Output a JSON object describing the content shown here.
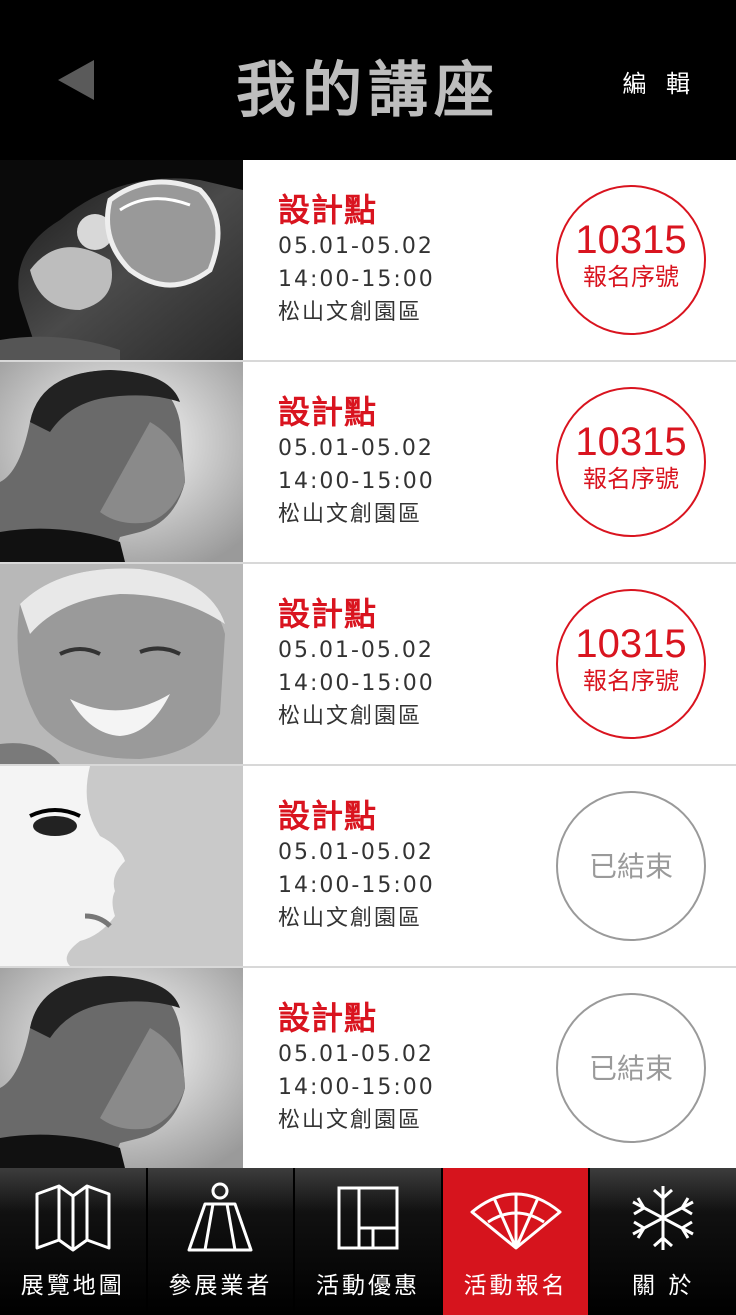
{
  "header": {
    "title": "我的講座",
    "edit_label": "編 輯",
    "back_icon": "back-arrow-icon"
  },
  "lectures": [
    {
      "title": "設計點",
      "date": "05.01-05.02",
      "time": "14:00-15:00",
      "venue": "松山文創園區",
      "status": "registered",
      "number": "10315",
      "number_label": "報名序號",
      "portrait": "portrait-man-sunglasses"
    },
    {
      "title": "設計點",
      "date": "05.01-05.02",
      "time": "14:00-15:00",
      "venue": "松山文創園區",
      "status": "registered",
      "number": "10315",
      "number_label": "報名序號",
      "portrait": "portrait-man-profile"
    },
    {
      "title": "設計點",
      "date": "05.01-05.02",
      "time": "14:00-15:00",
      "venue": "松山文創園區",
      "status": "registered",
      "number": "10315",
      "number_label": "報名序號",
      "portrait": "portrait-old-man-smiling"
    },
    {
      "title": "設計點",
      "date": "05.01-05.02",
      "time": "14:00-15:00",
      "venue": "松山文創園區",
      "status": "ended",
      "ended_label": "已結束",
      "portrait": "portrait-woman-profile"
    },
    {
      "title": "設計點",
      "date": "05.01-05.02",
      "time": "14:00-15:00",
      "venue": "松山文創園區",
      "status": "ended",
      "ended_label": "已結束",
      "portrait": "portrait-man-profile"
    }
  ],
  "tabs": [
    {
      "label": "展覽地圖",
      "icon": "map-icon",
      "active": false
    },
    {
      "label": "參展業者",
      "icon": "exhibitor-icon",
      "active": false
    },
    {
      "label": "活動優惠",
      "icon": "grid-icon",
      "active": false
    },
    {
      "label": "活動報名",
      "icon": "fan-icon",
      "active": true
    },
    {
      "label": "關 於",
      "icon": "snowflake-icon",
      "active": false
    }
  ],
  "colors": {
    "accent": "#d9141f",
    "ended": "#9a9a9a",
    "header_bg": "#000000",
    "title_text": "#bdbdbd"
  }
}
